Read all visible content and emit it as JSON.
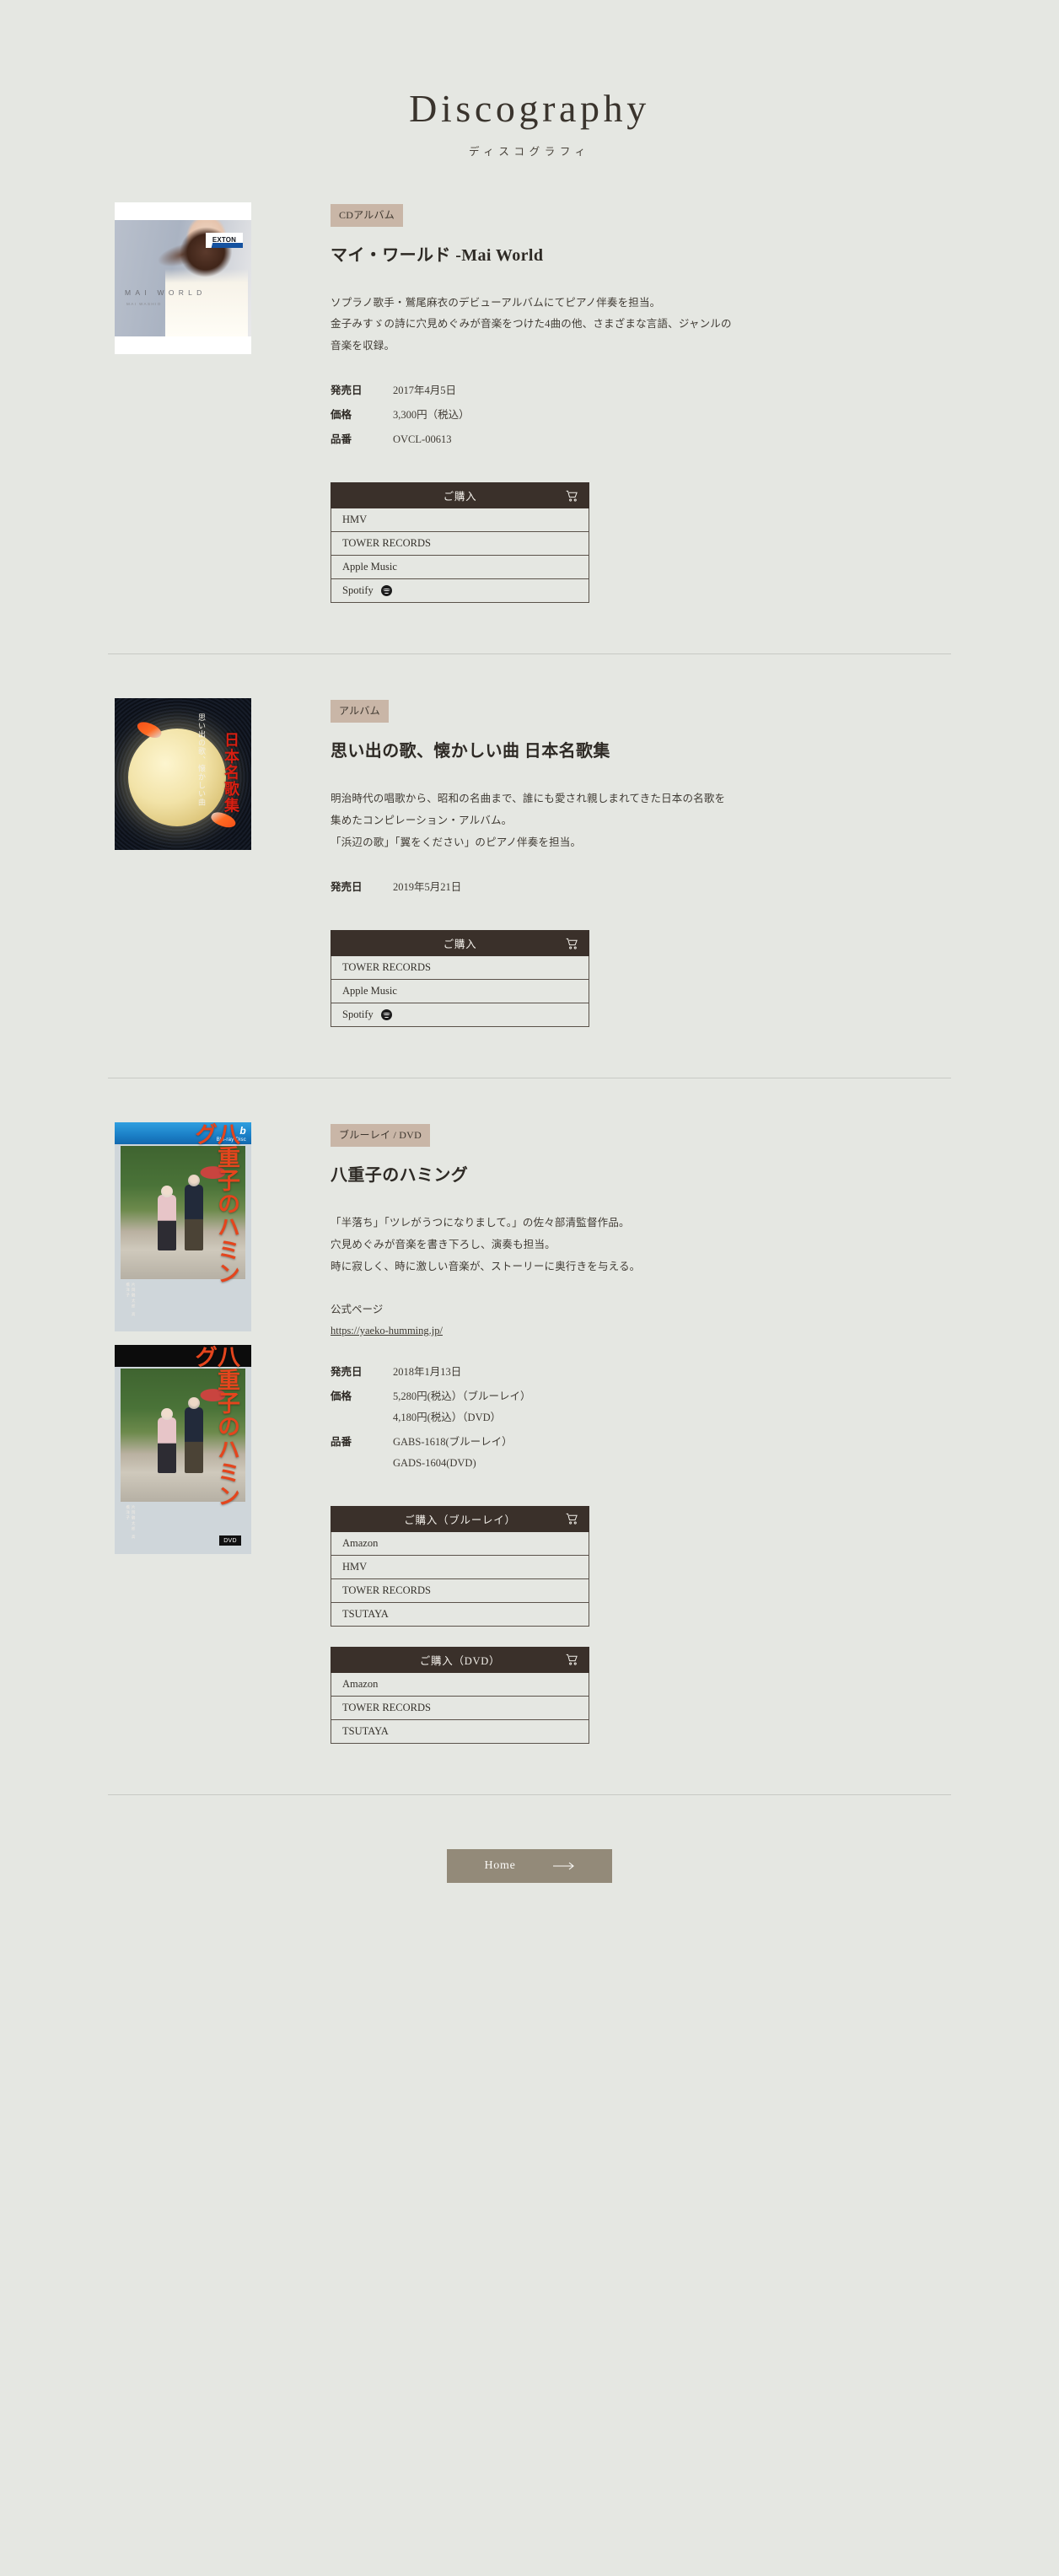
{
  "header": {
    "title_en": "Discography",
    "title_ja": "ディスコグラフィ"
  },
  "releases": [
    {
      "badge": "CDアルバム",
      "title": "マイ・ワールド -Mai World",
      "description": [
        "ソプラノ歌手・鷲尾麻衣のデビューアルバムにてピアノ伴奏を担当。",
        "金子みすゞの詩に穴見めぐみが音楽をつけた4曲の他、さまざまな言語、ジャンルの",
        "音楽を収録。"
      ],
      "specs": [
        {
          "key": "発売日",
          "values": [
            "2017年4月5日"
          ]
        },
        {
          "key": "価格",
          "values": [
            "3,300円（税込）"
          ]
        },
        {
          "key": "品番",
          "values": [
            "OVCL-00613"
          ]
        }
      ],
      "buyboxes": [
        {
          "heading": "ご購入",
          "cart_icon": "cart-icon",
          "items": [
            {
              "label": "HMV",
              "icon": null
            },
            {
              "label": "TOWER RECORDS",
              "icon": null
            },
            {
              "label": "Apple Music",
              "icon": null
            },
            {
              "label": "Spotify",
              "icon": "spotify-icon"
            }
          ]
        }
      ],
      "cover": {
        "type": "cd-mai-world",
        "label": "MAI WORLD",
        "sublabel": "MAI WASHIO",
        "imprint": "EXTON"
      }
    },
    {
      "badge": "アルバム",
      "title": "思い出の歌、懐かしい曲 日本名歌集",
      "description": [
        "明治時代の唱歌から、昭和の名曲まで、誰にも愛され親しまれてきた日本の名歌を",
        "集めたコンピレーション・アルバム。",
        "「浜辺の歌」「翼をください」のピアノ伴奏を担当。"
      ],
      "specs": [
        {
          "key": "発売日",
          "values": [
            "2019年5月21日"
          ]
        }
      ],
      "buyboxes": [
        {
          "heading": "ご購入",
          "cart_icon": "cart-icon",
          "items": [
            {
              "label": "TOWER RECORDS",
              "icon": null
            },
            {
              "label": "Apple Music",
              "icon": null
            },
            {
              "label": "Spotify",
              "icon": "spotify-icon"
            }
          ]
        }
      ],
      "cover": {
        "type": "cd-meikashu",
        "title_red": "日本名歌集",
        "title_white": "思い出の歌、懐かしい曲"
      }
    },
    {
      "badge": "ブルーレイ / DVD",
      "title": "八重子のハミング",
      "description": [
        "「半落ち」「ツレがうつになりまして。」の佐々部清監督作品。",
        "穴見めぐみが音楽を書き下ろし、演奏も担当。",
        "時に寂しく、時に激しい音楽が、ストーリーに奥行きを与える。"
      ],
      "official_label": "公式ページ",
      "official_url": "https://yaeko-humming.jp/",
      "specs": [
        {
          "key": "発売日",
          "values": [
            "2018年1月13日"
          ]
        },
        {
          "key": "価格",
          "values": [
            "5,280円(税込）（ブルーレイ）",
            "4,180円(税込）（DVD）"
          ]
        },
        {
          "key": "品番",
          "values": [
            "GABS-1618(ブルーレイ）",
            "GADS-1604(DVD)"
          ]
        }
      ],
      "buyboxes": [
        {
          "heading": "ご購入（ブルーレイ）",
          "cart_icon": "cart-icon",
          "items": [
            {
              "label": "Amazon",
              "icon": null
            },
            {
              "label": "HMV",
              "icon": null
            },
            {
              "label": "TOWER RECORDS",
              "icon": null
            },
            {
              "label": "TSUTAYA",
              "icon": null
            }
          ]
        },
        {
          "heading": "ご購入（DVD）",
          "cart_icon": "cart-icon",
          "items": [
            {
              "label": "Amazon",
              "icon": null
            },
            {
              "label": "TOWER RECORDS",
              "icon": null
            },
            {
              "label": "TSUTAYA",
              "icon": null
            }
          ]
        }
      ],
      "cover": {
        "type": "bluray-dvd",
        "title_jp": "八重子のハミング",
        "bluray_mark": "Blu-ray Disc",
        "dvd_mark": "DVD",
        "credits": "片 岡 鶴 太 郎　高 橋 洋 子"
      }
    }
  ],
  "footer": {
    "home_label": "Home",
    "arrow_icon": "arrow-right-icon"
  },
  "colors": {
    "page_bg": "#e5e7e2",
    "badge_bg": "#c9b6a7",
    "buy_header_bg": "#3a302a",
    "home_btn_bg": "#938a79",
    "text": "#3a3630"
  }
}
